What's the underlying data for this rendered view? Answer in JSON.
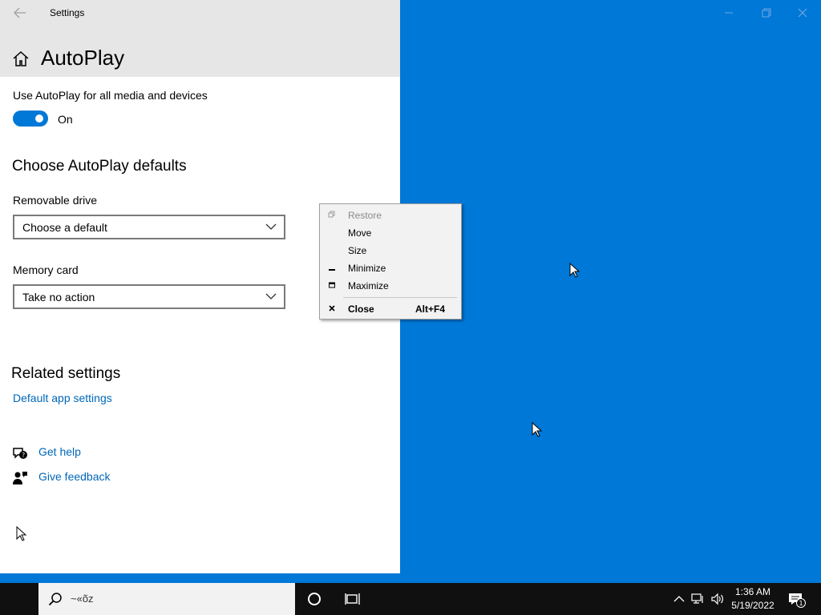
{
  "window": {
    "title": "Settings",
    "page_title": "AutoPlay"
  },
  "autoplay": {
    "use_label": "Use AutoPlay for all media and devices",
    "toggle_state": "On",
    "defaults_heading": "Choose AutoPlay defaults",
    "removable_drive": {
      "label": "Removable drive",
      "value": "Choose a default"
    },
    "memory_card": {
      "label": "Memory card",
      "value": "Take no action"
    }
  },
  "related": {
    "heading": "Related settings",
    "default_app_link": "Default app settings",
    "get_help": "Get help",
    "give_feedback": "Give feedback"
  },
  "context_menu": {
    "items": [
      {
        "label": "Restore",
        "icon": "restore-icon",
        "disabled": true
      },
      {
        "label": "Move",
        "icon": "",
        "disabled": false
      },
      {
        "label": "Size",
        "icon": "",
        "disabled": false
      },
      {
        "label": "Minimize",
        "icon": "minimize-icon",
        "disabled": false
      },
      {
        "label": "Maximize",
        "icon": "maximize-icon",
        "disabled": false
      },
      {
        "label": "Close",
        "icon": "close-icon",
        "accelerator": "Alt+F4",
        "disabled": false
      }
    ]
  },
  "taskbar": {
    "search_text": "~«õz",
    "time": "1:36 AM",
    "date": "5/19/2022",
    "notification_count": "1"
  },
  "colors": {
    "accent": "#0078d7",
    "link": "#0067b8",
    "header_bg": "#e6e6e6",
    "taskbar": "#101010"
  }
}
